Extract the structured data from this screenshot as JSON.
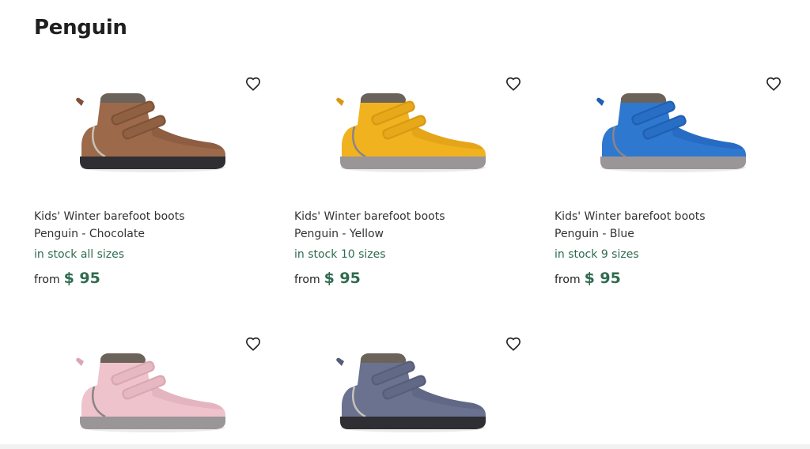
{
  "page": {
    "title": "Penguin"
  },
  "products": [
    {
      "name_line1": "Kids' Winter barefoot boots",
      "name_line2": "Penguin - Chocolate",
      "stock": "in stock all sizes",
      "from_label": "from",
      "price": "$ 95",
      "colors": {
        "upper": "#9c6a4a",
        "upper_shade": "#7e5238",
        "sole": "#2e2e33",
        "piping": "#c8c2b8",
        "fur": "#6b625a"
      },
      "fav_icon": "heart-outline-icon"
    },
    {
      "name_line1": "Kids' Winter barefoot boots",
      "name_line2": "Penguin - Yellow",
      "stock": "in stock 10 sizes",
      "from_label": "from",
      "price": "$ 95",
      "colors": {
        "upper": "#f0b21f",
        "upper_shade": "#d99812",
        "sole": "#9a9596",
        "piping": "#8a8586",
        "fur": "#6b625a"
      },
      "fav_icon": "heart-outline-icon"
    },
    {
      "name_line1": "Kids' Winter barefoot boots",
      "name_line2": "Penguin - Blue",
      "stock": "in stock 9 sizes",
      "from_label": "from",
      "price": "$ 95",
      "colors": {
        "upper": "#2f78d0",
        "upper_shade": "#1f5fb3",
        "sole": "#9a9596",
        "piping": "#8a8586",
        "fur": "#6b625a"
      },
      "fav_icon": "heart-outline-icon"
    },
    {
      "colors": {
        "upper": "#eec3cc",
        "upper_shade": "#d9a7b3",
        "sole": "#9a9596",
        "piping": "#8a8586",
        "fur": "#6b625a"
      },
      "fav_icon": "heart-outline-icon"
    },
    {
      "colors": {
        "upper": "#6a7290",
        "upper_shade": "#565d7a",
        "sole": "#2e2e33",
        "piping": "#c8c2b8",
        "fur": "#6b625a"
      },
      "fav_icon": "heart-outline-icon"
    }
  ]
}
